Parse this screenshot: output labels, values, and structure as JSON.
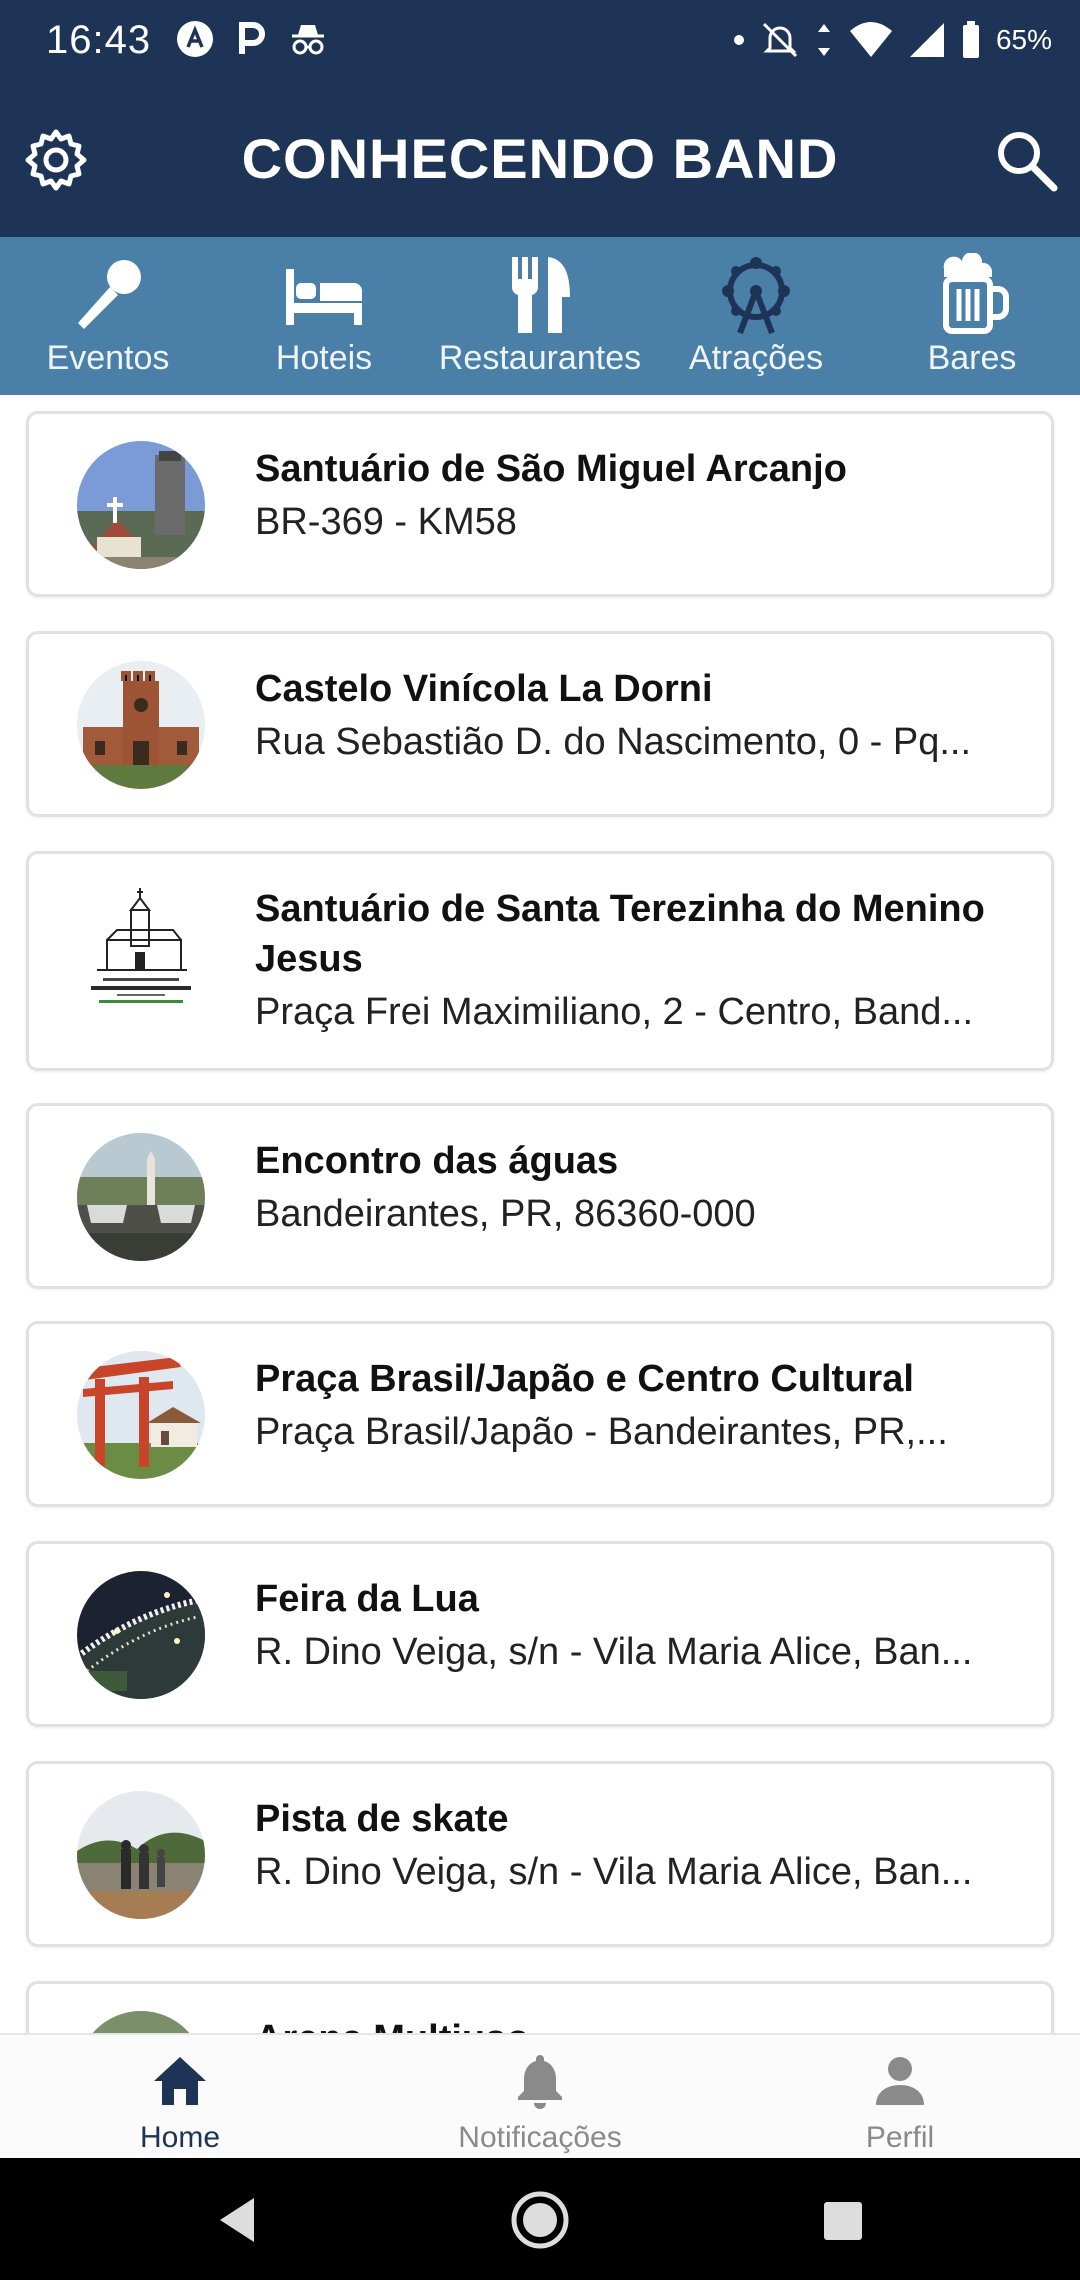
{
  "status_bar": {
    "time": "16:43",
    "battery": "65%"
  },
  "app_bar": {
    "title": "CONHECENDO BAND"
  },
  "categories": [
    {
      "label": "Eventos",
      "icon": "microphone-icon"
    },
    {
      "label": "Hoteis",
      "icon": "bed-icon"
    },
    {
      "label": "Restaurantes",
      "icon": "fork-knife-icon"
    },
    {
      "label": "Atrações",
      "icon": "ferris-wheel-icon"
    },
    {
      "label": "Bares",
      "icon": "beer-mug-icon"
    }
  ],
  "places": [
    {
      "title": "Santuário de São Miguel Arcanjo",
      "address": "BR-369 - KM58"
    },
    {
      "title": "Castelo Vinícola La Dorni",
      "address": "Rua Sebastião D. do Nascimento, 0 - Pq..."
    },
    {
      "title": "Santuário de Santa Terezinha do Menino Jesus",
      "address": "Praça Frei Maximiliano, 2 - Centro, Band..."
    },
    {
      "title": "Encontro das águas",
      "address": "Bandeirantes, PR, 86360-000"
    },
    {
      "title": "Praça Brasil/Japão e Centro Cultural",
      "address": "Praça Brasil/Japão - Bandeirantes, PR,..."
    },
    {
      "title": "Feira da Lua",
      "address": "R. Dino Veiga, s/n - Vila Maria Alice, Ban..."
    },
    {
      "title": "Pista de skate",
      "address": "R. Dino Veiga, s/n - Vila Maria Alice, Ban..."
    },
    {
      "title": "Arena Multiuso",
      "address": ""
    }
  ],
  "bottom_nav": [
    {
      "label": "Home",
      "icon": "home-icon",
      "active": true
    },
    {
      "label": "Notificações",
      "icon": "bell-icon",
      "active": false
    },
    {
      "label": "Perfil",
      "icon": "person-icon",
      "active": false
    }
  ],
  "colors": {
    "primary": "#1e3457",
    "category_bar": "#4a7fa8",
    "active_nav": "#1e3457",
    "inactive_nav": "#8a8a8a"
  }
}
